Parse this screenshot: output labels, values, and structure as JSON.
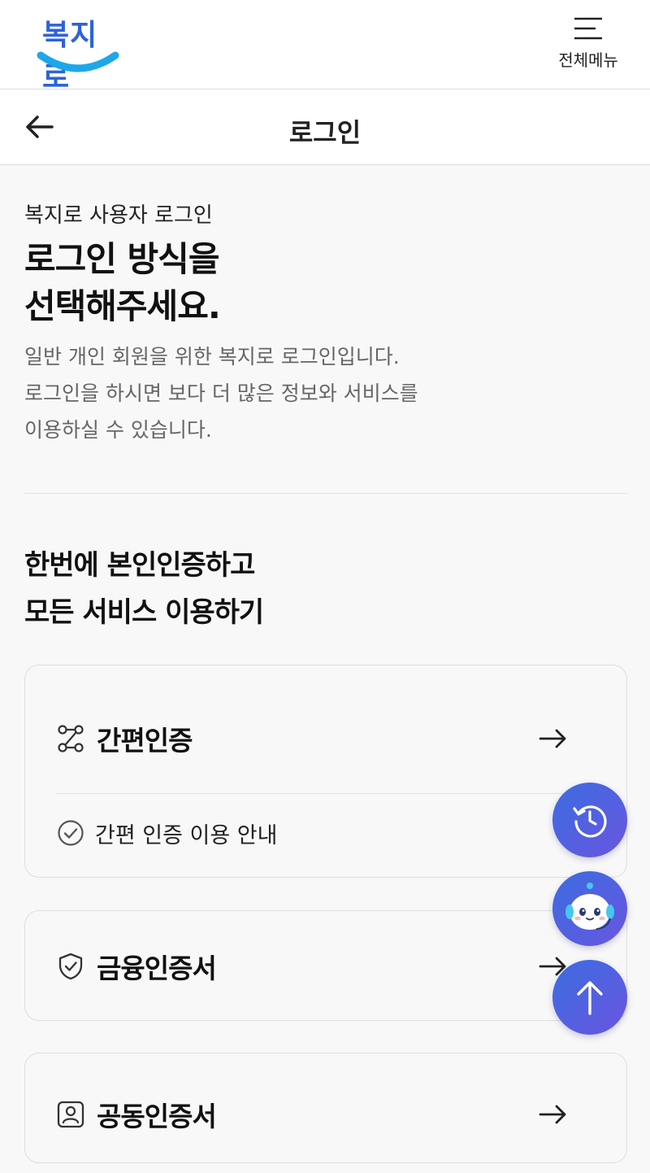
{
  "header": {
    "logo_text": "복지로",
    "menu_label": "전체메뉴"
  },
  "subheader": {
    "title": "로그인"
  },
  "intro": {
    "kicker": "복지로 사용자 로그인",
    "title_line1": "로그인 방식을",
    "title_line2": "선택해주세요.",
    "desc_line1": "일반 개인 회원을 위한 복지로 로그인입니다.",
    "desc_line2": "로그인을 하시면 보다 더 많은 정보와 서비스를",
    "desc_line3": "이용하실 수 있습니다."
  },
  "section": {
    "title_line1": "한번에 본인인증하고",
    "title_line2": "모든 서비스 이용하기"
  },
  "methods": [
    {
      "label": "간편인증",
      "icon": "route-icon",
      "guide": "간편 인증 이용 안내"
    },
    {
      "label": "금융인증서",
      "icon": "shield-check-icon"
    },
    {
      "label": "공동인증서",
      "icon": "id-card-icon"
    }
  ],
  "fabs": [
    {
      "icon": "history-icon"
    },
    {
      "icon": "chatbot-icon"
    },
    {
      "icon": "scroll-top-icon"
    }
  ],
  "colors": {
    "logo_blue": "#2d63d9",
    "logo_smile": "#1ea7e8",
    "fab_start": "#3a6de0",
    "fab_end": "#6a55e0"
  }
}
